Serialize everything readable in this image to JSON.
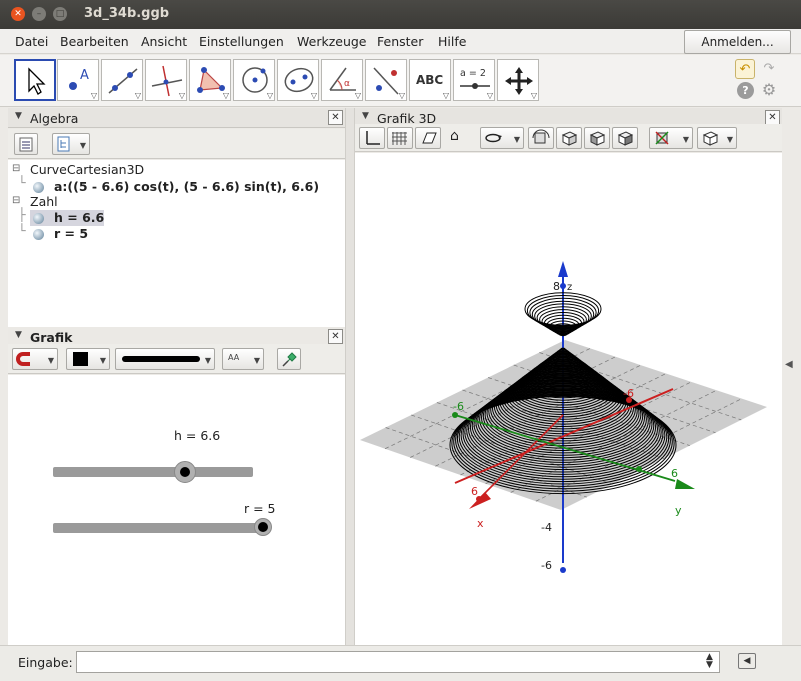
{
  "window": {
    "title": "3d_34b.ggb"
  },
  "menu": {
    "items": [
      "Datei",
      "Bearbeiten",
      "Ansicht",
      "Einstellungen",
      "Werkzeuge",
      "Fenster",
      "Hilfe"
    ],
    "login_label": "Anmelden..."
  },
  "toolbar": {
    "abc_label": "ABC",
    "slider_label": "a = 2",
    "point_label": "A"
  },
  "algebra": {
    "title": "Algebra",
    "groups": [
      {
        "label": "CurveCartesian3D",
        "items": [
          {
            "text": "a:((5 - 6.6) cos(t), (5 - 6.6) sin(t), 6.6)"
          }
        ]
      },
      {
        "label": "Zahl",
        "items": [
          {
            "text": "h = 6.6"
          },
          {
            "text": "r = 5"
          }
        ]
      }
    ]
  },
  "grafik": {
    "title": "Grafik",
    "aa_label": "AA"
  },
  "sliders": [
    {
      "label": "h = 6.6",
      "name": "h",
      "value": 6.6,
      "min": 0,
      "max": 10
    },
    {
      "label": "r = 5",
      "name": "r",
      "value": 5,
      "min": 0,
      "max": 5
    }
  ],
  "grafik3d": {
    "title": "Grafik 3D",
    "axes": {
      "x_label": "x",
      "y_label": "y",
      "z_label": "z"
    },
    "tick_labels": {
      "z_top": "8",
      "z_neg4": "-4",
      "z_neg6": "-6",
      "x_pos": "6",
      "x_neg": "-6",
      "y_pos": "6",
      "y_neg": "-6"
    }
  },
  "input": {
    "label": "Eingabe:",
    "value": ""
  },
  "colors": {
    "accent": "#2b4bb1",
    "x_axis": "#cc2020",
    "y_axis": "#1a8a1a",
    "z_axis": "#1a3acc"
  }
}
